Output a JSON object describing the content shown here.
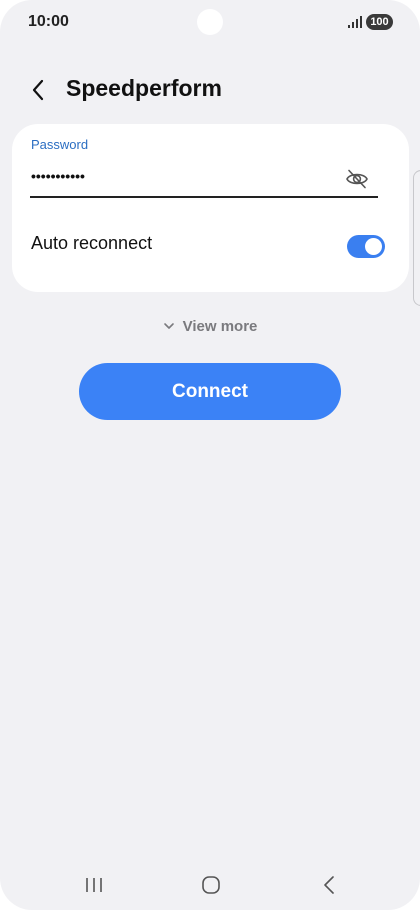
{
  "status_bar": {
    "time": "10:00",
    "battery": "100"
  },
  "header": {
    "title": "Speedperform"
  },
  "form": {
    "password_label": "Password",
    "password_value": "•••••••••••",
    "auto_reconnect_label": "Auto reconnect",
    "auto_reconnect_on": true
  },
  "view_more_label": "View more",
  "connect_label": "Connect",
  "colors": {
    "accent": "#3b82f6",
    "label_blue": "#2b6ec2",
    "background": "#f1f1f4"
  },
  "icons": {
    "back": "chevron-left-icon",
    "visibility": "eye-off-icon",
    "view_more": "chevron-down-icon",
    "nav_recents": "recents-icon",
    "nav_home": "home-icon",
    "nav_back": "back-icon"
  }
}
